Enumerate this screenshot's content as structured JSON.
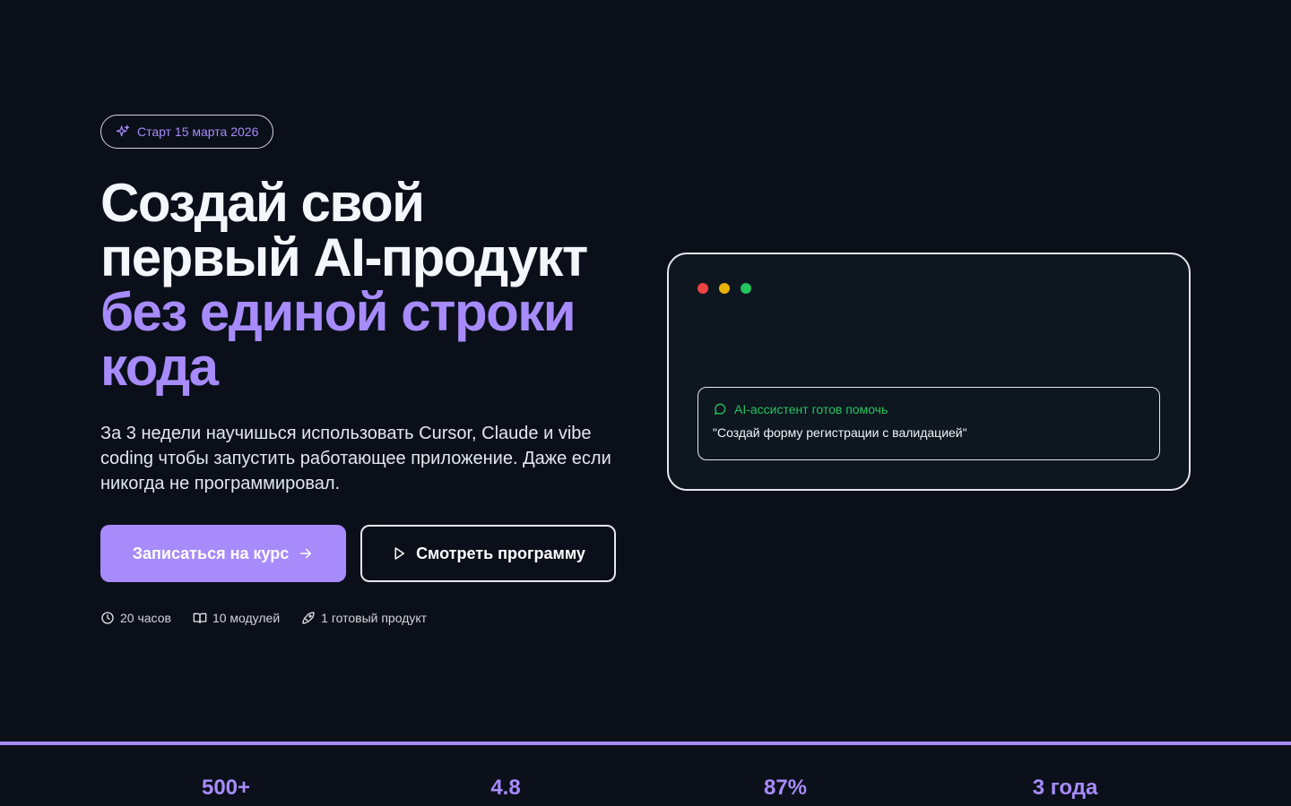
{
  "badge": {
    "icon": "sparkles-icon",
    "label": "Старт 15 марта 2026"
  },
  "headline": {
    "line1": "Создай свой",
    "line2": "первый AI-продукт",
    "line3": "без единой строки",
    "line4": "кода"
  },
  "lead": "За 3 недели научишься использовать Cursor, Claude и vibe coding чтобы запустить работающее приложение. Даже если никогда не программировал.",
  "buttons": {
    "primary": "Записаться на курс",
    "secondary": "Смотреть программу"
  },
  "meta": [
    {
      "icon": "clock-icon",
      "label": "20 часов"
    },
    {
      "icon": "book-icon",
      "label": "10 модулей"
    },
    {
      "icon": "rocket-icon",
      "label": "1 готовый продукт"
    }
  ],
  "window": {
    "dots": [
      "#ef4444",
      "#eab308",
      "#22c55e"
    ],
    "assistant_label": "AI-ассистент готов помочь",
    "message": "\"Создай форму регистрации с валидацией\""
  },
  "stats": [
    "500+",
    "4.8",
    "87%",
    "3 года"
  ],
  "colors": {
    "accent": "#a78bfa",
    "background": "#0a0f1a",
    "success": "#22c55e"
  }
}
